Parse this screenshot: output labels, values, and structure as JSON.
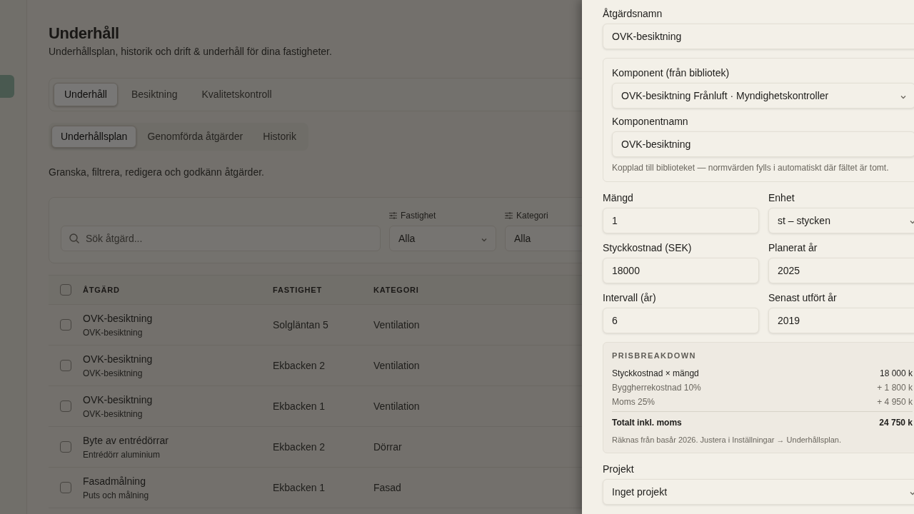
{
  "sidebar": {
    "items": [
      {
        "selected": true
      }
    ]
  },
  "page": {
    "title": "Underhåll",
    "subtitle": "Underhållsplan, historik och drift & underhåll för dina fastigheter.",
    "tabs": [
      {
        "label": "Underhåll",
        "selected": true
      },
      {
        "label": "Besiktning",
        "selected": false
      },
      {
        "label": "Kvalitetskontroll",
        "selected": false
      }
    ],
    "subtabs": [
      {
        "label": "Underhållsplan",
        "selected": true
      },
      {
        "label": "Genomförda åtgärder",
        "selected": false
      },
      {
        "label": "Historik",
        "selected": false
      }
    ],
    "description": "Granska, filtrera, redigera och godkänn åtgärder.",
    "filters": {
      "search": {
        "placeholder": "Sök åtgärd..."
      },
      "selects": [
        {
          "label": "Fastighet",
          "value": "Alla"
        },
        {
          "label": "Kategori",
          "value": "Alla"
        }
      ]
    },
    "table": {
      "select_all": {
        "checked": false
      },
      "columns": [
        "ÅTGÄRD",
        "FASTIGHET",
        "KATEGORI"
      ],
      "rows": [
        {
          "name": "OVK-besiktning",
          "component": "OVK-besiktning",
          "property": "Solgläntan 5",
          "category": "Ventilation",
          "checked": false
        },
        {
          "name": "OVK-besiktning",
          "component": "OVK-besiktning",
          "property": "Ekbacken 2",
          "category": "Ventilation",
          "checked": false
        },
        {
          "name": "OVK-besiktning",
          "component": "OVK-besiktning",
          "property": "Ekbacken 1",
          "category": "Ventilation",
          "checked": false
        },
        {
          "name": "Byte av entrédörrar",
          "component": "Entrédörr aluminium",
          "property": "Ekbacken 2",
          "category": "Dörrar",
          "checked": false
        },
        {
          "name": "Fasadmålning",
          "component": "Puts och målning",
          "property": "Ekbacken 1",
          "category": "Fasad",
          "checked": false
        }
      ]
    }
  },
  "drawer": {
    "name_field": {
      "label": "Åtgärdsnamn",
      "value": "OVK-besiktning"
    },
    "component_group": {
      "select": {
        "label": "Komponent (från bibliotek)",
        "value": "OVK-besiktning Frånluft · Myndighetskontroller"
      },
      "name": {
        "label": "Komponentnamn",
        "value": "OVK-besiktning"
      },
      "hint": "Kopplad till biblioteket — normvärden fylls i automatiskt där fältet är tomt."
    },
    "grid": [
      {
        "label": "Mängd",
        "value": "1",
        "kind": "input"
      },
      {
        "label": "Enhet",
        "value": "st – stycken",
        "kind": "select"
      },
      {
        "label": "Styckkostnad (SEK)",
        "value": "18000",
        "kind": "input"
      },
      {
        "label": "Planerat år",
        "value": "2025",
        "kind": "input"
      },
      {
        "label": "Intervall (år)",
        "value": "6",
        "kind": "input"
      },
      {
        "label": "Senast utfört år",
        "value": "2019",
        "kind": "input"
      }
    ],
    "breakdown": {
      "title": "PRISBREAKDOWN",
      "lines": [
        {
          "label": "Styckkostnad × mängd",
          "value": "18 000 k",
          "kind": "base"
        },
        {
          "label": "Byggherrekostnad 10%",
          "value": "+ 1 800 k",
          "kind": "addition"
        },
        {
          "label": "Moms 25%",
          "value": "+ 4 950 k",
          "kind": "addition"
        },
        {
          "label": "Totalt inkl. moms",
          "value": "24 750 k",
          "kind": "total"
        }
      ],
      "note": "Räknas från basår 2026. Justera i Inställningar → Underhållsplan."
    },
    "project": {
      "label": "Projekt",
      "value": "Inget projekt"
    }
  }
}
